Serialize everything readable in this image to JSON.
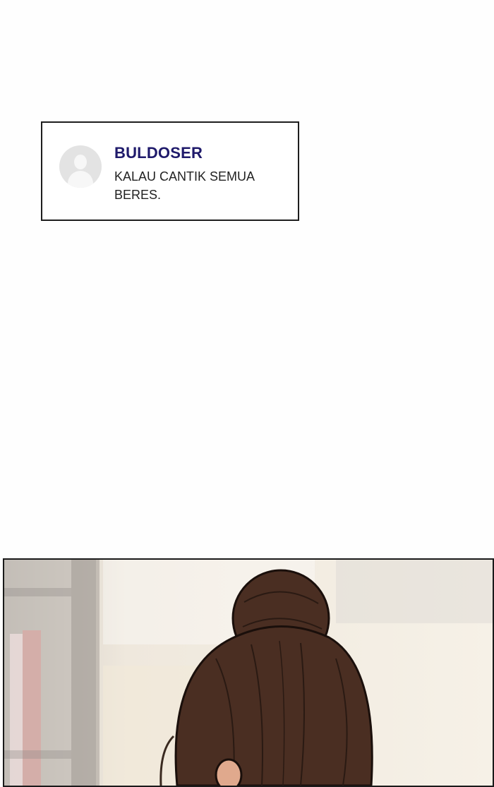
{
  "comment": {
    "username": "BULDOSER",
    "text": "KALAU CANTIK SEMUA BERES."
  },
  "colors": {
    "username": "#1f1a6b",
    "hair": "#4a2e22",
    "background": "#fefefe"
  },
  "icons": {
    "avatar": "default-user-avatar-icon"
  }
}
